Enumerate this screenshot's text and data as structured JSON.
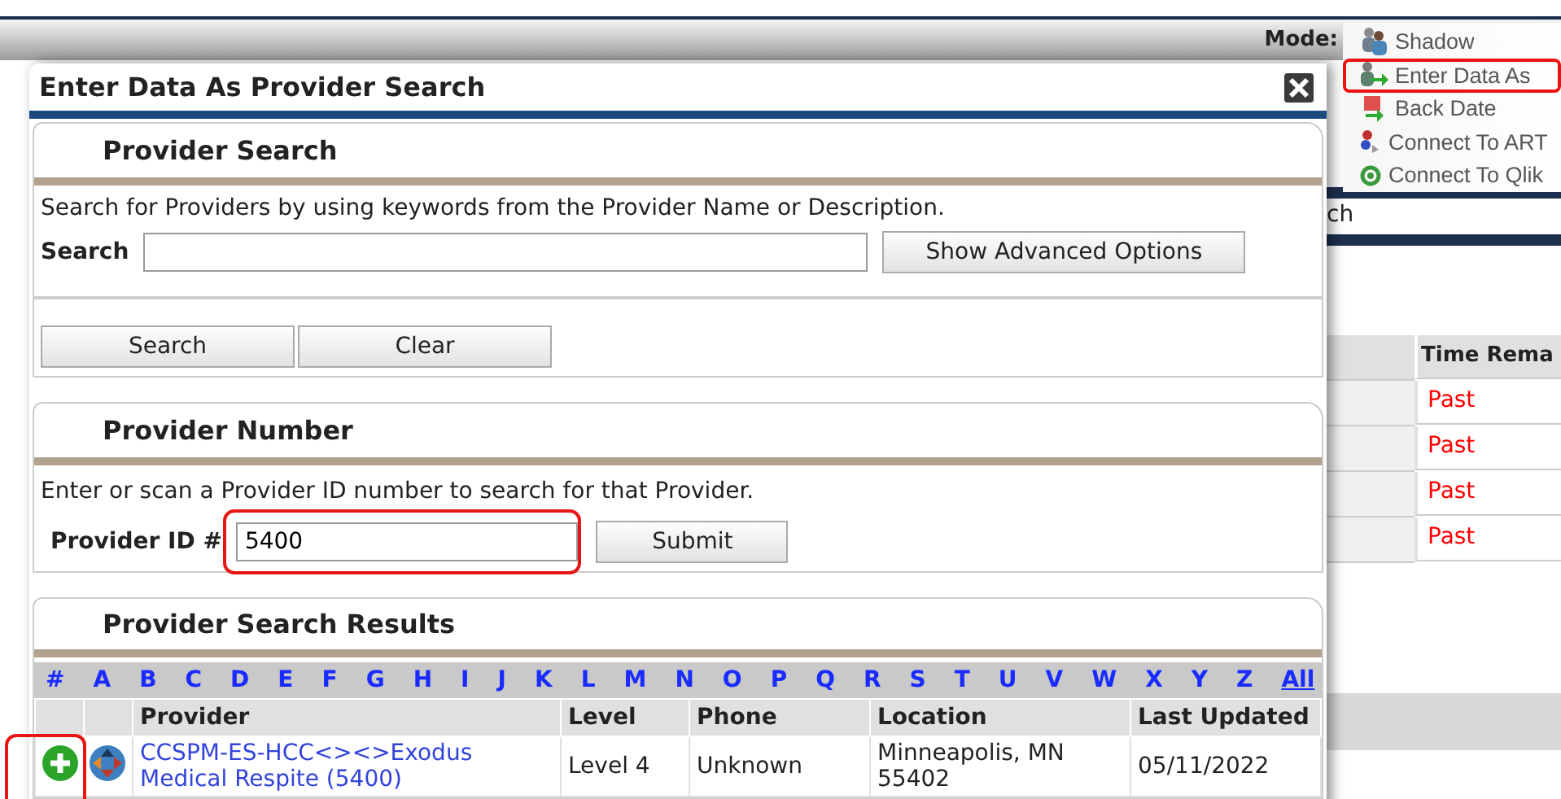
{
  "app_header": {
    "mode_label": "Mode:"
  },
  "mode_menu": {
    "items": [
      {
        "kind": "shadow",
        "label": "Shadow",
        "annotated": false
      },
      {
        "kind": "enter",
        "label": "Enter Data As",
        "annotated": true
      },
      {
        "kind": "backdate",
        "label": "Back Date",
        "annotated": false
      },
      {
        "kind": "art",
        "label": "Connect To ART",
        "annotated": false
      },
      {
        "kind": "qlik",
        "label": "Connect To Qlik",
        "annotated": false
      }
    ]
  },
  "background_page": {
    "search_text": "ch",
    "table": {
      "column_header": "Time Rema",
      "rows": [
        "Past",
        "Past",
        "Past",
        "Past"
      ]
    }
  },
  "dialog": {
    "title": "Enter Data As Provider Search",
    "provider_search": {
      "heading": "Provider Search",
      "description": "Search for Providers by using keywords from the Provider Name or Description.",
      "search_label": "Search",
      "advanced_button": "Show Advanced Options",
      "buttons": [
        "Search",
        "Clear"
      ]
    },
    "provider_number": {
      "heading": "Provider Number",
      "description": "Enter or scan a Provider ID number to search for that Provider.",
      "id_label": "Provider ID #",
      "id_value": "5400",
      "annotated": true,
      "submit_button": "Submit"
    },
    "results": {
      "heading": "Provider Search Results",
      "letters": [
        "#",
        "A",
        "B",
        "C",
        "D",
        "E",
        "F",
        "G",
        "H",
        "I",
        "J",
        "K",
        "L",
        "M",
        "N",
        "O",
        "P",
        "Q",
        "R",
        "S",
        "T",
        "U",
        "V",
        "W",
        "X",
        "Y",
        "Z"
      ],
      "all_link": "All",
      "columns": [
        "Provider",
        "Level",
        "Phone",
        "Location",
        "Last Updated"
      ],
      "rows": [
        {
          "provider": "CCSPM-ES-HCC<><>Exodus Medical Respite (5400)",
          "level": "Level 4",
          "phone": "Unknown",
          "location": "Minneapolis, MN 55402",
          "last_updated": "05/11/2022",
          "annotated": true
        }
      ]
    }
  }
}
